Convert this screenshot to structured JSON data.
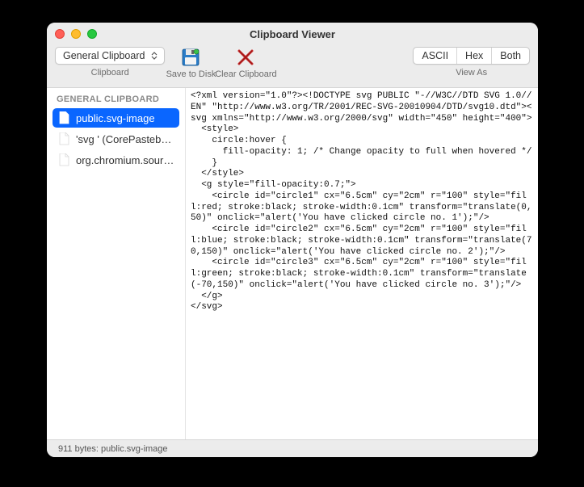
{
  "window": {
    "title": "Clipboard Viewer"
  },
  "toolbar": {
    "clipboard_select": {
      "value": "General Clipboard",
      "label": "Clipboard"
    },
    "save": {
      "label": "Save to Disk"
    },
    "clear": {
      "label": "Clear Clipboard"
    },
    "view_as": {
      "label": "View As",
      "options": [
        "ASCII",
        "Hex",
        "Both"
      ]
    }
  },
  "sidebar": {
    "section": "GENERAL CLIPBOARD",
    "items": [
      {
        "label": "public.svg-image",
        "selected": true
      },
      {
        "label": "'svg ' (CorePastebo…",
        "selected": false
      },
      {
        "label": "org.chromium.sourc…",
        "selected": false
      }
    ]
  },
  "content": "<?xml version=\"1.0\"?><!DOCTYPE svg PUBLIC \"-//W3C//DTD SVG 1.0//EN\" \"http://www.w3.org/TR/2001/REC-SVG-20010904/DTD/svg10.dtd\"><svg xmlns=\"http://www.w3.org/2000/svg\" width=\"450\" height=\"400\">\n  <style>\n    circle:hover {\n      fill-opacity: 1; /* Change opacity to full when hovered */\n    }\n  </style>\n  <g style=\"fill-opacity:0.7;\">\n    <circle id=\"circle1\" cx=\"6.5cm\" cy=\"2cm\" r=\"100\" style=\"fill:red; stroke:black; stroke-width:0.1cm\" transform=\"translate(0,50)\" onclick=\"alert('You have clicked circle no. 1');\"/>\n    <circle id=\"circle2\" cx=\"6.5cm\" cy=\"2cm\" r=\"100\" style=\"fill:blue; stroke:black; stroke-width:0.1cm\" transform=\"translate(70,150)\" onclick=\"alert('You have clicked circle no. 2');\"/>\n    <circle id=\"circle3\" cx=\"6.5cm\" cy=\"2cm\" r=\"100\" style=\"fill:green; stroke:black; stroke-width:0.1cm\" transform=\"translate(-70,150)\" onclick=\"alert('You have clicked circle no. 3');\"/>\n  </g>\n</svg>",
  "status": "911 bytes: public.svg-image"
}
